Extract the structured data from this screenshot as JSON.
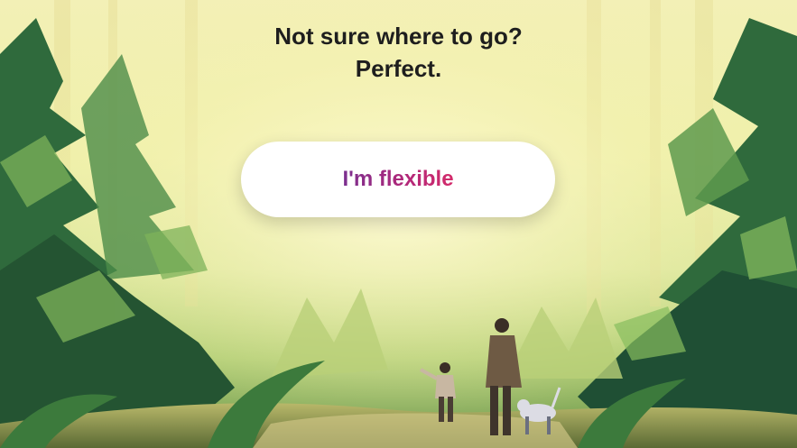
{
  "hero": {
    "headline_line1": "Not sure where to go?",
    "headline_line2": "Perfect.",
    "button_label": "I'm flexible"
  },
  "colors": {
    "headline_text": "#1e1e1e",
    "button_background": "#ffffff",
    "button_text_gradient_start": "#7a2f8f",
    "button_text_gradient_end": "#d42a6a",
    "forest_light": "#f3f0b6",
    "forest_dark": "#2e5a34"
  },
  "illustration": {
    "subject": "forest-walk-illustration",
    "figures": [
      "adult-figure",
      "child-figure",
      "dog-figure"
    ]
  }
}
